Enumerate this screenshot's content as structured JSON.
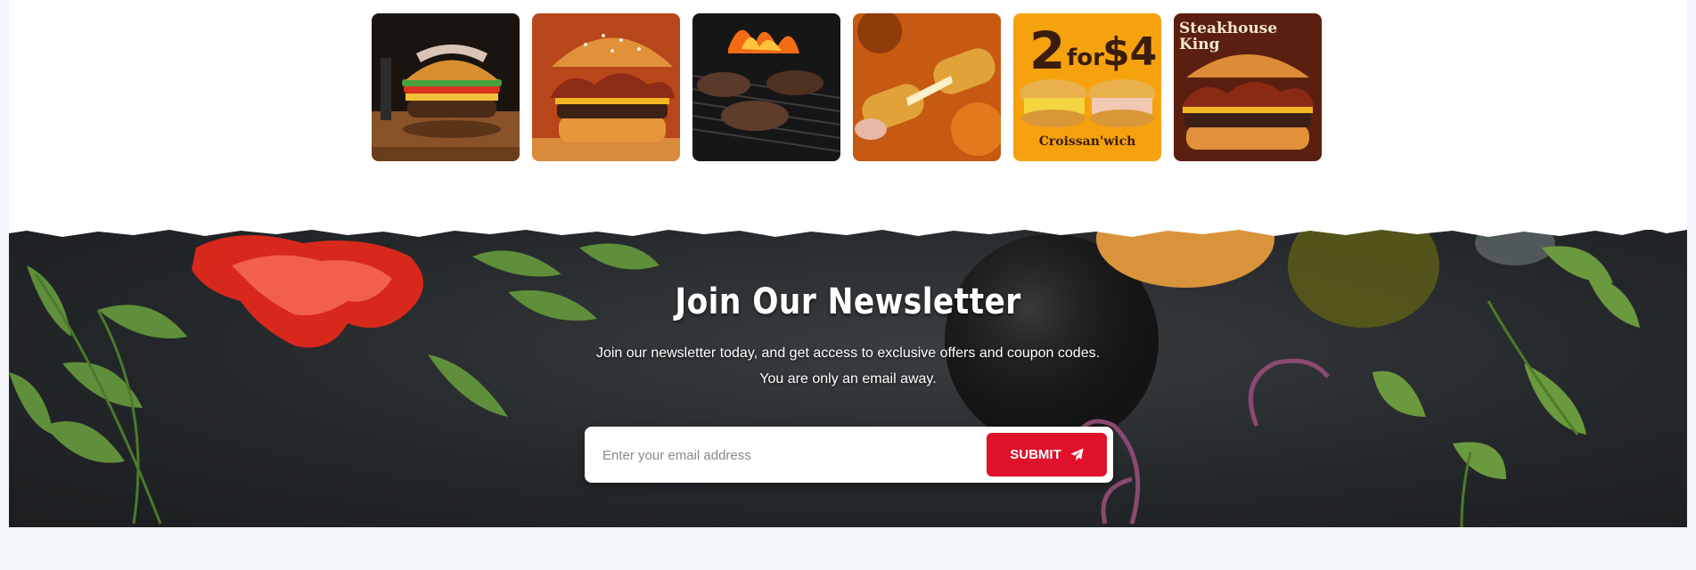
{
  "gallery": {
    "items": [
      {
        "name": "burger-hands-photo",
        "alt": "Burger being assembled by hand"
      },
      {
        "name": "bacon-burger-photo",
        "alt": "Bacon burger with crispy onions"
      },
      {
        "name": "grill-patties-photo",
        "alt": "Patties on flaming grill"
      },
      {
        "name": "cheese-stick-photo",
        "alt": "Mozzarella stick with cheese pull"
      },
      {
        "name": "promo-2for4-photo",
        "alt": "2 for $4 Croissan'wich promo",
        "promo_big": "2",
        "promo_for": "for",
        "promo_price": "$4",
        "promo_caption": "Croissan'wich"
      },
      {
        "name": "steakhouse-king-photo",
        "alt": "Steakhouse King burger",
        "promo_title_1": "Steakhouse",
        "promo_title_2": "King"
      }
    ]
  },
  "newsletter": {
    "title": "Join Our Newsletter",
    "line1": "Join our newsletter today, and get access to exclusive offers and coupon codes.",
    "line2": "You are only an email away.",
    "email_placeholder": "Enter your email address",
    "submit_label": "SUBMIT",
    "submit_icon": "paper-plane-icon"
  },
  "colors": {
    "accent": "#e0112b",
    "background": "#f4f7fb",
    "newsletter_bg": "#25282b",
    "promo_orange": "#f6a20e",
    "promo_brown": "#5a1f0e"
  }
}
